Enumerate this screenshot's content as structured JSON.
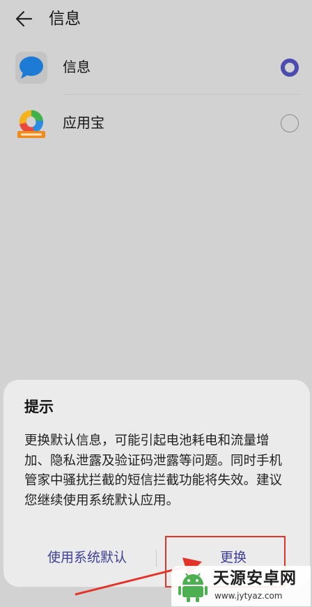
{
  "header": {
    "back_icon": "arrow-left-icon",
    "title": "信息"
  },
  "apps": [
    {
      "name": "信息",
      "icon": "messages-app-icon",
      "selected": true
    },
    {
      "name": "应用宝",
      "icon": "yingyongbao-app-icon",
      "selected": false
    }
  ],
  "dialog": {
    "title": "提示",
    "message": "更换默认信息，可能引起电池耗电和流量增加、隐私泄露及验证码泄露等问题。同时手机管家中骚扰拦截的短信拦截功能将失效。建议您继续使用系统默认应用。",
    "buttons": {
      "keep_default": "使用系统默认",
      "replace": "更换"
    }
  },
  "watermark": {
    "title": "天源安卓网",
    "url": "www.jytyaz.com"
  },
  "colors": {
    "background": "#d2d2d2",
    "dialog": "#ebebeb",
    "accent": "#4b4bb0",
    "button_text": "#3f3f98",
    "annotation": "#e33228"
  }
}
